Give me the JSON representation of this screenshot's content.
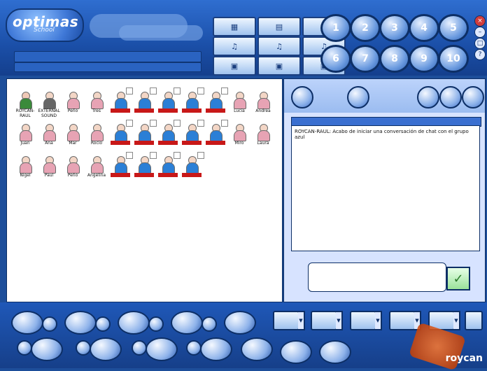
{
  "app": {
    "logo_text": "optimas",
    "logo_sub": "School",
    "brand_text": "roycan",
    "window_controls": [
      "close",
      "minimize",
      "restore",
      "help"
    ]
  },
  "toolbar": {
    "tool_buttons": [
      "media-1",
      "media-2",
      "media-3",
      "media-4",
      "media-5",
      "media-6",
      "media-7",
      "media-8",
      "media-9"
    ],
    "numbers": [
      "1",
      "2",
      "3",
      "4",
      "5",
      "6",
      "7",
      "8",
      "9",
      "10"
    ]
  },
  "users": [
    {
      "label": "ROYCAN-RAUL",
      "state": "special"
    },
    {
      "label": "EXTERNAL SOUND",
      "state": "camera"
    },
    {
      "label": "Peño",
      "state": "normal"
    },
    {
      "label": "Tres",
      "state": "normal"
    },
    {
      "label": "",
      "state": "active"
    },
    {
      "label": "",
      "state": "active"
    },
    {
      "label": "",
      "state": "active"
    },
    {
      "label": "",
      "state": "active"
    },
    {
      "label": "",
      "state": "active"
    },
    {
      "label": "Lucia",
      "state": "normal"
    },
    {
      "label": "Andrea",
      "state": "normal"
    },
    {
      "label": "Juan",
      "state": "normal"
    },
    {
      "label": "Ana",
      "state": "normal"
    },
    {
      "label": "Mar",
      "state": "normal"
    },
    {
      "label": "Rocio",
      "state": "normal"
    },
    {
      "label": "",
      "state": "active"
    },
    {
      "label": "",
      "state": "active"
    },
    {
      "label": "",
      "state": "active"
    },
    {
      "label": "",
      "state": "active"
    },
    {
      "label": "",
      "state": "active"
    },
    {
      "label": "Miro",
      "state": "normal"
    },
    {
      "label": "Laura",
      "state": "normal"
    },
    {
      "label": "Nigel",
      "state": "normal"
    },
    {
      "label": "Paul",
      "state": "normal"
    },
    {
      "label": "Peño",
      "state": "normal"
    },
    {
      "label": "Angelina",
      "state": "normal"
    },
    {
      "label": "",
      "state": "active"
    },
    {
      "label": "",
      "state": "active"
    },
    {
      "label": "",
      "state": "active"
    },
    {
      "label": "",
      "state": "active"
    }
  ],
  "chat": {
    "message": "ROYCAN-RAUL: Acabo de iniciar una conversación de chat con el grupo azul"
  }
}
